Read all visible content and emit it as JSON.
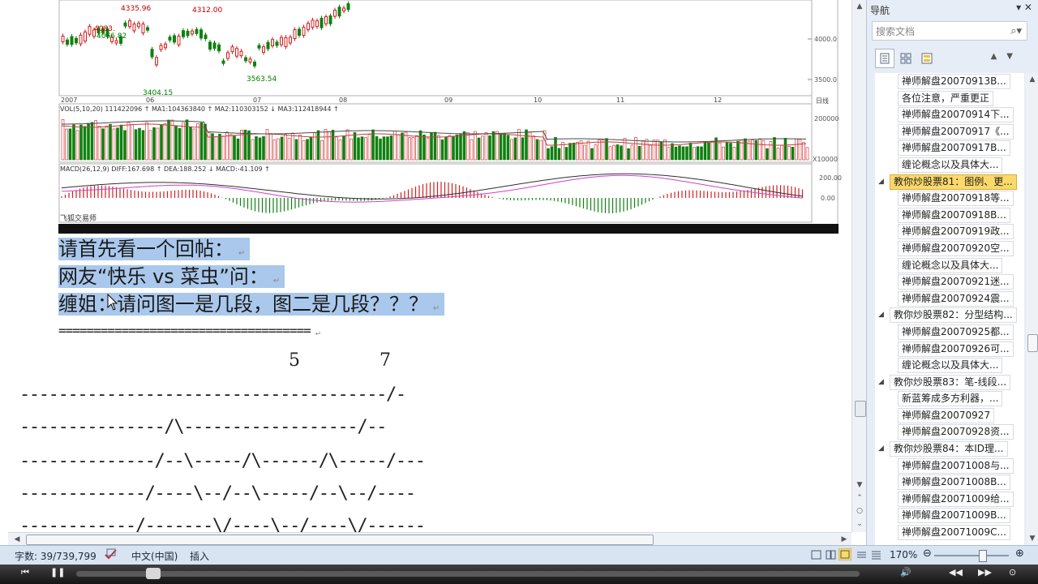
{
  "chart": {
    "price_labels": [
      "4335.96",
      "4312.00",
      "4083.",
      "4066.82",
      "3404.15",
      "3563.54"
    ],
    "y_ticks": [
      "4000.0",
      "3500.0"
    ],
    "x_labels": [
      "2007",
      "06",
      "07",
      "08",
      "09",
      "10",
      "11",
      "12",
      "日线"
    ],
    "vol_header": "VOL(5,10,20) 111422096 ↑ MA1:104363840 ↑ MA2:110303152 ↓ MA3:112418944 ↑",
    "vol_tick": "200000",
    "vol_unit": "X10000",
    "macd_header": "MACD(26,12,9) DIFF:167.698 ↑ DEA:188.252 ↓ MACD:-41.109 ↑",
    "macd_ticks": [
      "200.00",
      "0.00"
    ],
    "brand": "飞狐交易师"
  },
  "doc": {
    "lines": [
      "请首先看一个回帖：",
      "网友“快乐 vs 菜虫”问：",
      "缠姐：请问图一是几段，图二是几段？？？"
    ],
    "pilcrow": "↵",
    "separator": "====================================",
    "num_left": "5",
    "num_right": "7",
    "ascii": [
      "--------------------------------------/-",
      "---------------/\\------------------/--",
      "--------------/--\\-----/\\------/\\-----/---",
      "-------------/----\\--/--\\-----/--\\--/----",
      "------------/-------\\/----\\--/----\\/------"
    ]
  },
  "nav": {
    "title": "导航",
    "controls": "▾ ✕",
    "search_placeholder": "搜索文档",
    "search_icon": "🔍",
    "items": [
      {
        "level": 1,
        "label": "禅师解盘20070913B..."
      },
      {
        "level": 1,
        "label": "各位注意，严重更正"
      },
      {
        "level": 1,
        "label": "禅师解盘20070914下..."
      },
      {
        "level": 1,
        "label": "禅师解盘20070917《..."
      },
      {
        "level": 1,
        "label": "禅师解盘20070917B..."
      },
      {
        "level": 1,
        "label": "缠论概念以及具体大..."
      },
      {
        "level": 0,
        "label": "教你炒股票81：图例、更...",
        "active": true
      },
      {
        "level": 1,
        "label": "禅师解盘20070918等..."
      },
      {
        "level": 1,
        "label": "禅师解盘20070918B..."
      },
      {
        "level": 1,
        "label": "禅师解盘20070919政..."
      },
      {
        "level": 1,
        "label": "禅师解盘20070920空..."
      },
      {
        "level": 1,
        "label": "缠论概念以及具体大..."
      },
      {
        "level": 1,
        "label": "禅师解盘20070921迷..."
      },
      {
        "level": 1,
        "label": "禅师解盘20070924震..."
      },
      {
        "level": 0,
        "label": "教你炒股票82：分型结构..."
      },
      {
        "level": 1,
        "label": "禅师解盘20070925都..."
      },
      {
        "level": 1,
        "label": "禅师解盘20070926可..."
      },
      {
        "level": 1,
        "label": "缠论概念以及具体大..."
      },
      {
        "level": 0,
        "label": "教你炒股票83：笔-线段..."
      },
      {
        "level": 1,
        "label": "新蓝筹成多方利器，..."
      },
      {
        "level": 1,
        "label": "禅师解盘20070927"
      },
      {
        "level": 1,
        "label": "禅师解盘20070928资..."
      },
      {
        "level": 0,
        "label": "教你炒股票84：本ID理..."
      },
      {
        "level": 1,
        "label": "禅师解盘20071008与..."
      },
      {
        "level": 1,
        "label": "禅师解盘20071008B..."
      },
      {
        "level": 1,
        "label": "禅师解盘20071009给..."
      },
      {
        "level": 1,
        "label": "禅师解盘20071009B..."
      },
      {
        "level": 1,
        "label": "禅师解盘20071009C..."
      }
    ]
  },
  "status": {
    "word_count": "字数: 39/739,799",
    "language": "中文(中国)",
    "mode": "插入",
    "zoom": "170%",
    "zoom_fraction": 0.62
  },
  "player": {
    "progress": 0.09
  }
}
